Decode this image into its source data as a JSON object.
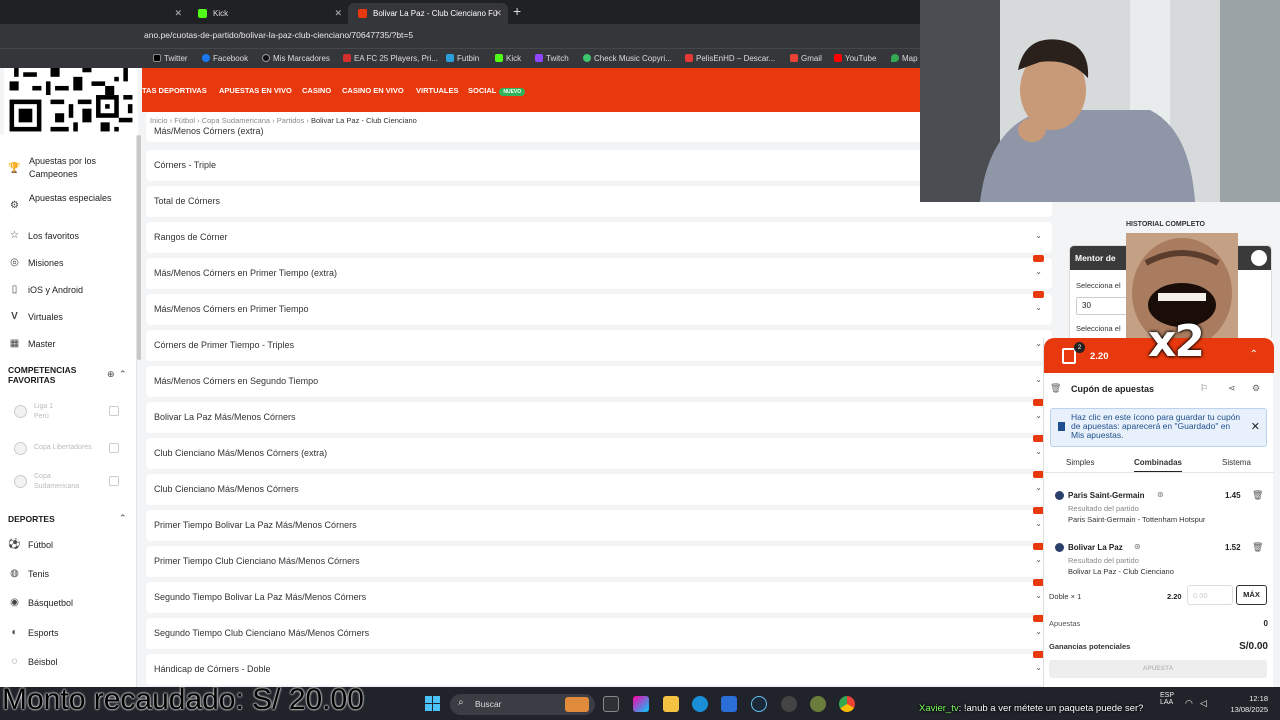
{
  "browser": {
    "tabs": [
      {
        "label": "",
        "active": false
      },
      {
        "label": "Kick",
        "active": false
      },
      {
        "label": "Bolivar La Paz - Club Cienciano Fú",
        "active": true
      }
    ],
    "url": "ano.pe/cuotas-de-partido/bolivar-la-paz-club-cienciano/70647735/?bt=5",
    "bookmarks": [
      "Twitter",
      "Facebook",
      "Mis Marcadores",
      "EA FC 25 Players, Pri...",
      "Futbin",
      "Kick",
      "Twitch",
      "Check Music Copyri...",
      "PelisEnHD – Descar...",
      "Gmail",
      "YouTube",
      "Map"
    ]
  },
  "nav": {
    "items": [
      "TAS DEPORTIVAS",
      "APUESTAS EN VIVO",
      "CASINO",
      "CASINO EN VIVO",
      "VIRTUALES",
      "SOCIAL"
    ],
    "social_badge": "NUEVO"
  },
  "sidebar": {
    "items": [
      {
        "label": "Apuestas por los Campeones",
        "icon": "trophy-icon"
      },
      {
        "label": "Apuestas especiales",
        "icon": "special-icon"
      },
      {
        "label": "Los favoritos",
        "icon": "star-icon"
      },
      {
        "label": "Misiones",
        "icon": "target-icon"
      },
      {
        "label": "iOS y Android",
        "icon": "phone-icon"
      },
      {
        "label": "Virtuales",
        "icon": "virtual-icon"
      },
      {
        "label": "Master",
        "icon": "master-icon"
      }
    ],
    "fav_title": "COMPETENCIAS FAVORITAS",
    "favorites": [
      {
        "label": "Liga 1",
        "sub": "Perú"
      },
      {
        "label": "Copa Libertadores",
        "sub": ""
      },
      {
        "label": "Copa Sudamericana",
        "sub": ""
      }
    ],
    "sports_title": "DEPORTES",
    "sports": [
      "Fútbol",
      "Tenis",
      "Básquetbol",
      "Esports",
      "Béisbol"
    ]
  },
  "breadcrumb": [
    "Inicio",
    "Fútbol",
    "Copa Sudamericana",
    "Partidos",
    "Bolivar La Paz - Club Cienciano"
  ],
  "partial_row": "Más/Menos Córners (extra)",
  "markets": [
    {
      "name": "Córners - Triple",
      "bb": false
    },
    {
      "name": "Total de Córners",
      "bb": false
    },
    {
      "name": "Rangos de Córner",
      "bb": false
    },
    {
      "name": "Más/Menos Córners en Primer Tiempo (extra)",
      "bb": true
    },
    {
      "name": "Más/Menos Córners en Primer Tiempo",
      "bb": true
    },
    {
      "name": "Córners de Primer Tiempo - Triples",
      "bb": false
    },
    {
      "name": "Más/Menos Córners en Segundo Tiempo",
      "bb": false
    },
    {
      "name": "Bolivar La Paz Más/Menos Córners",
      "bb": true
    },
    {
      "name": "Club Cienciano Más/Menos Córners (extra)",
      "bb": true
    },
    {
      "name": "Club Cienciano Más/Menos Córners",
      "bb": true
    },
    {
      "name": "Primer Tiempo Bolivar La Paz Más/Menos Córners",
      "bb": true
    },
    {
      "name": "Primer Tiempo Club Cienciano Más/Menos Córners",
      "bb": true
    },
    {
      "name": "Segundo Tiempo Bolivar La Paz Más/Menos Córners",
      "bb": true
    },
    {
      "name": "Segundo Tiempo Club Cienciano Más/Menos Córners",
      "bb": true
    },
    {
      "name": "Hándicap de Córners - Doble",
      "bb": true
    }
  ],
  "history": {
    "title": "HISTORIAL COMPLETO",
    "mentor_title": "Mentor de",
    "select_label_1": "Selecciona el",
    "input_value": "30",
    "select_label_2": "Selecciona el"
  },
  "overlay_text": "x2",
  "coupon": {
    "count": "2",
    "odds": "2.20",
    "title": "Cupón de apuestas",
    "hint": "Haz clic en este ícono para guardar tu cupón de apuestas: aparecerá en \"Guardado\" en Mis apuestas.",
    "tabs": [
      "Simples",
      "Combinadas",
      "Sistema"
    ],
    "active_tab": 1,
    "selections": [
      {
        "team": "Paris Saint-Germain",
        "odds": "1.45",
        "type": "Resultado del partido",
        "match": "Paris Saint-Germain - Tottenham Hotspur"
      },
      {
        "team": "Bolivar La Paz",
        "odds": "1.52",
        "type": "Resultado del partido",
        "match": "Bolivar La Paz - Club Cienciano"
      }
    ],
    "double_label": "Doble × 1",
    "double_odds": "2.20",
    "stake_placeholder": "0.00",
    "max_label": "MÁX",
    "bets_label": "Apuestas",
    "bets_value": "0",
    "winnings_label": "Ganancias potenciales",
    "winnings_value": "S/0.00",
    "bet_button": "APUESTA"
  },
  "stream": {
    "monto": "Monto recaudado: S/ 20.00",
    "chat_user": "Xavier_tv",
    "chat_msg": ": !anub a ver métete un paqueta puede ser?"
  },
  "taskbar": {
    "search": "Buscar",
    "lang": "ESP",
    "lang2": "LAA",
    "time": "12:18",
    "date": "13/08/2025"
  }
}
